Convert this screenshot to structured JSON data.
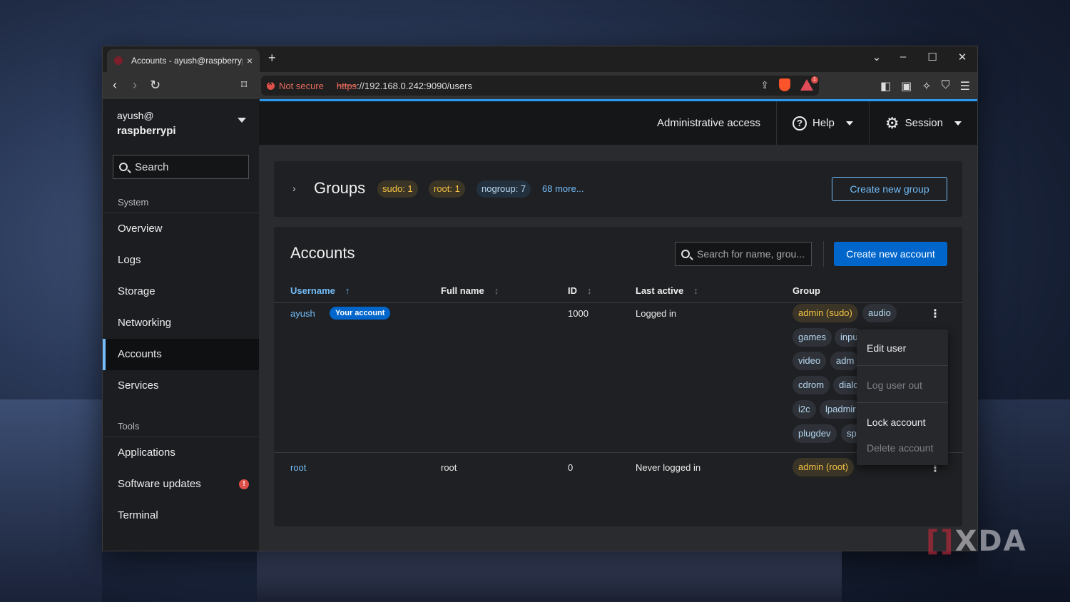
{
  "browser": {
    "tab_title": "Accounts - ayush@raspberrypi",
    "tab_close": "×",
    "new_tab": "+",
    "not_secure": "Not secure",
    "url_scheme": "https",
    "url_rest": "://192.168.0.242:9090/users",
    "bat_badge": "1"
  },
  "sidebar": {
    "user": "ayush@",
    "host": "raspberrypi",
    "search_placeholder": "Search",
    "system_label": "System",
    "system_items": [
      "Overview",
      "Logs",
      "Storage",
      "Networking",
      "Accounts",
      "Services"
    ],
    "active_item": "Accounts",
    "tools_label": "Tools",
    "tools_items": [
      "Applications",
      "Software updates",
      "Terminal"
    ],
    "updates_badge": "!"
  },
  "masthead": {
    "admin": "Administrative access",
    "help": "Help",
    "session": "Session"
  },
  "groups": {
    "title": "Groups",
    "pills": [
      "sudo: 1",
      "root: 1",
      "nogroup: 7"
    ],
    "more": "68 more...",
    "create_button": "Create new group"
  },
  "accounts": {
    "title": "Accounts",
    "search_placeholder": "Search for name, grou...",
    "create_button": "Create new account",
    "columns": [
      "Username",
      "Full name",
      "ID",
      "Last active",
      "Group"
    ],
    "rows": [
      {
        "username": "ayush",
        "badge": "Your account",
        "full_name": "",
        "id": "1000",
        "last_active": "Logged in",
        "groups": [
          "admin (sudo)",
          "audio",
          "games",
          "inpu",
          "video",
          "adm",
          "cdrom",
          "dialc",
          "i2c",
          "lpadmir",
          "plugdev",
          "spi"
        ]
      },
      {
        "username": "root",
        "full_name": "root",
        "id": "0",
        "last_active": "Never logged in",
        "groups": [
          "admin (root)"
        ]
      }
    ]
  },
  "context_menu": {
    "items": [
      "Edit user",
      "Log user out",
      "Lock account",
      "Delete account"
    ]
  },
  "watermark": "XDA",
  "colors": {
    "accent": "#73bcf7",
    "primary": "#0066cc",
    "gold": "#f4c145",
    "danger": "#e0504a"
  }
}
